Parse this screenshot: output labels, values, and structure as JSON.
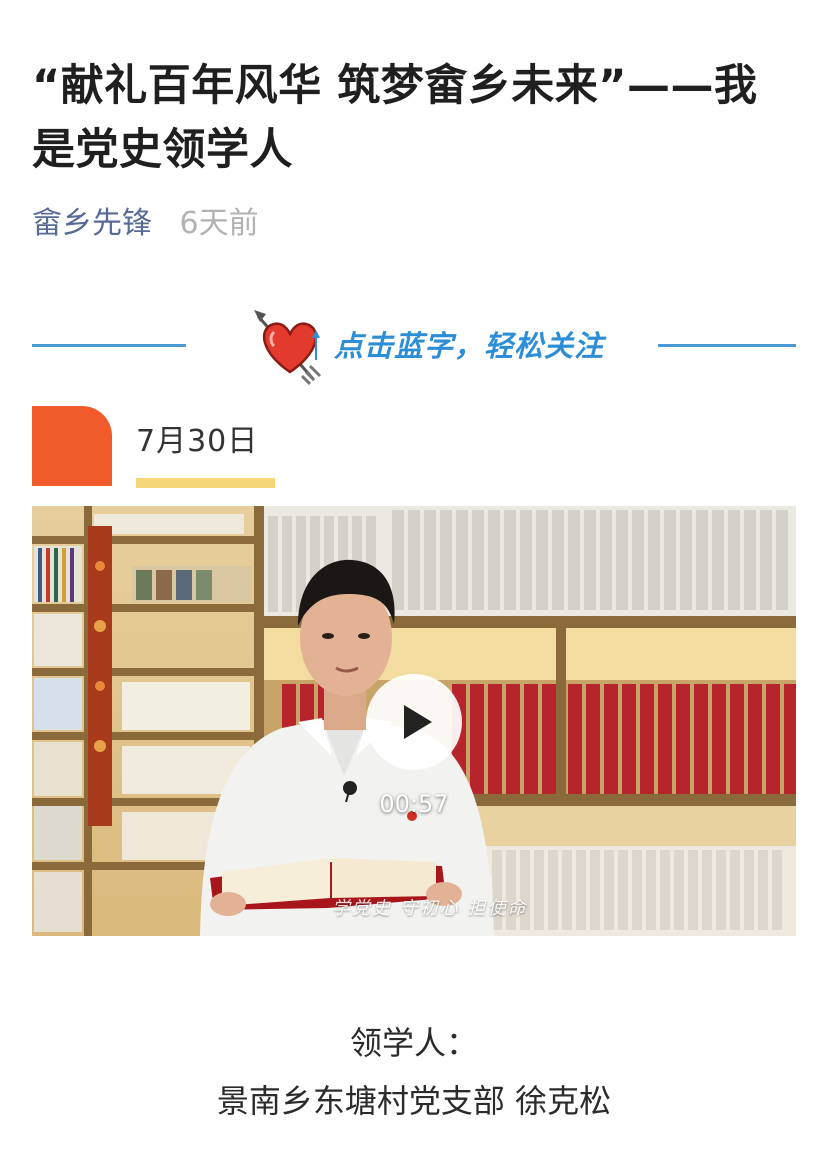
{
  "article": {
    "title": "“献礼百年风华 筑梦畲乡未来”——我是党史领学人",
    "author": "畲乡先锋",
    "time": "6天前"
  },
  "follow_banner": {
    "text": "点击蓝字，轻松关注",
    "icon": "heart-arrow-icon",
    "line_color": "#4a9ad8",
    "text_color": "#2d8ed6"
  },
  "date_header": {
    "date": "7月30日",
    "accent_color": "#f15a2b",
    "underline_color": "#f7d878"
  },
  "video": {
    "duration": "00:57",
    "subtitle": "学党史 守初心 担使命",
    "play_icon": "play-icon"
  },
  "caption": {
    "label": "领学人：",
    "name": "景南乡东塘村党支部 徐克松"
  }
}
